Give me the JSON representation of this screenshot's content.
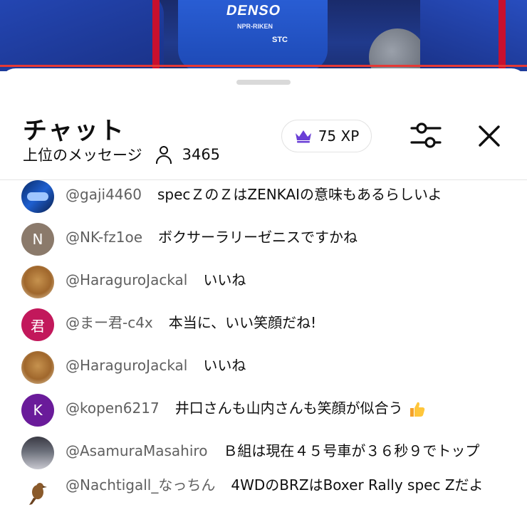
{
  "chat": {
    "title": "チャット",
    "mode_label": "上位のメッセージ",
    "viewer_count": "3465",
    "xp_label": "75 XP",
    "brand_color": "#6a3fd6"
  },
  "video": {
    "logo_text": "DENSO",
    "sub_text": "NPR-RIKEN",
    "stc_text": "STC"
  },
  "messages": [
    {
      "author": "@gaji4460",
      "text": "specＺのＺはZENKAIの意味もあるらしいよ",
      "avatar": "car-icon",
      "initial": ""
    },
    {
      "author": "@NK-fz1oe",
      "text": "ボクサーラリーゼニスですかね",
      "avatar": "letter",
      "initial": "N"
    },
    {
      "author": "@HaraguroJackal",
      "text": "いいね",
      "avatar": "dog-icon",
      "initial": ""
    },
    {
      "author": "@まー君-c4x",
      "text": "本当に、いい笑顔だね!",
      "avatar": "letter",
      "initial": "君"
    },
    {
      "author": "@HaraguroJackal",
      "text": "いいね",
      "avatar": "dog-icon",
      "initial": ""
    },
    {
      "author": "@kopen6217",
      "text": "井口さんも山内さんも笑顔が似合う",
      "avatar": "letter",
      "initial": "K",
      "emoji": "thumbs-up-icon"
    },
    {
      "author": "@AsamuraMasahiro",
      "text": "Ｂ組は現在４５号車が３６秒９でトップ",
      "avatar": "race-car-icon",
      "initial": ""
    },
    {
      "author": "@Nachtigall_なっちん",
      "text": "4WDのBRZはBoxer Rally spec Zだよ",
      "avatar": "bird-icon",
      "initial": ""
    }
  ]
}
